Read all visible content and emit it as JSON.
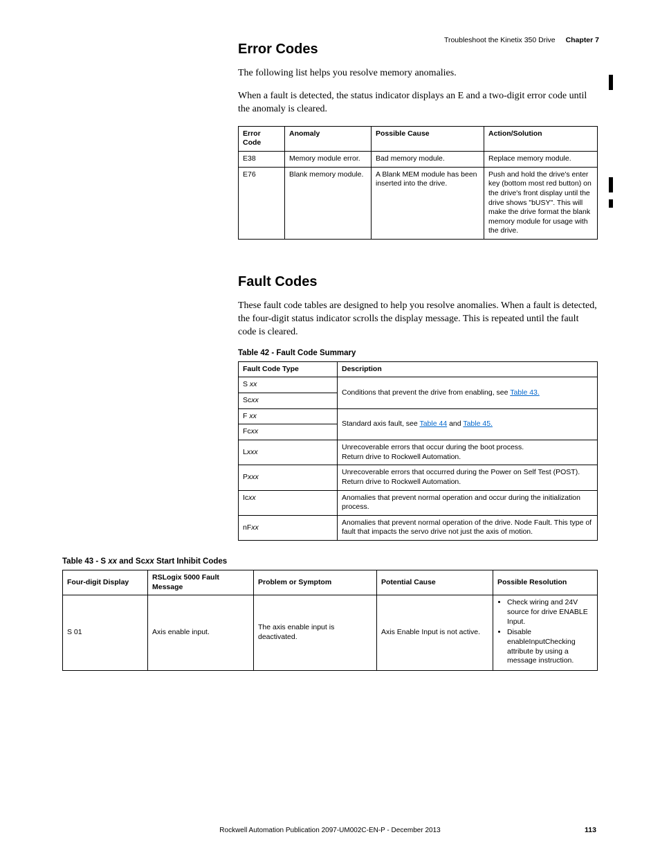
{
  "header": {
    "breadcrumb": "Troubleshoot the Kinetix 350 Drive",
    "chapter": "Chapter 7"
  },
  "sectionA": {
    "title": "Error Codes",
    "p1": "The following list helps you resolve memory anomalies.",
    "p2": "When a fault is detected, the status indicator displays an E and a two-digit error code until the anomaly is cleared."
  },
  "errorTable": {
    "headers": [
      "Error Code",
      "Anomaly",
      "Possible Cause",
      "Action/Solution"
    ],
    "rows": [
      {
        "code": "E38",
        "anomaly": "Memory module error.",
        "cause": "Bad memory module.",
        "action": "Replace memory module."
      },
      {
        "code": "E76",
        "anomaly": "Blank memory module.",
        "cause": "A Blank MEM module has been inserted into the drive.",
        "action": "Push and hold the drive's enter key (bottom most red button) on the drive's front display until the drive shows \"bUSY\".  This will make the drive format the blank memory module for usage with the drive."
      }
    ]
  },
  "sectionB": {
    "title": "Fault Codes",
    "p1": "These fault code tables are designed to help you resolve anomalies. When a fault is detected, the four-digit status indicator scrolls the display message. This is repeated until the fault code is cleared."
  },
  "faultSummary": {
    "caption": "Table 42 - Fault Code Summary",
    "headers": [
      "Fault Code Type",
      "Description"
    ],
    "rows": [
      {
        "type_pre": "S ",
        "type_it": "xx",
        "desc_pre": "Conditions that prevent the drive from enabling, see ",
        "desc_link": "Table 43.",
        "desc_post": "",
        "rowspan": 2
      },
      {
        "type_pre": "Sc",
        "type_it": "xx"
      },
      {
        "type_pre": "F ",
        "type_it": "xx",
        "desc_pre": "Standard axis fault, see ",
        "desc_link": "Table 44",
        "desc_mid": " and ",
        "desc_link2": "Table 45.",
        "rowspan": 2
      },
      {
        "type_pre": "Fc",
        "type_it": "xx"
      },
      {
        "type_pre": "L",
        "type_it": "xxx",
        "desc_plain": "Unrecoverable errors that occur during the boot process.\nReturn drive to Rockwell Automation."
      },
      {
        "type_pre": "P",
        "type_it": "xxx",
        "desc_plain": "Unrecoverable errors that occurred during the Power on Self Test (POST). Return drive to Rockwell Automation."
      },
      {
        "type_pre": "Ic",
        "type_it": "xx",
        "desc_plain": "Anomalies that prevent normal operation and occur during the initialization process."
      },
      {
        "type_pre": "nF",
        "type_it": "xx",
        "desc_plain": "Anomalies that prevent normal operation of the drive. Node Fault. This type of fault that impacts the servo drive not just the axis of motion."
      }
    ]
  },
  "inhibit": {
    "caption_pre": "Table 43 -  S ",
    "caption_it1": "xx",
    "caption_mid": " and Sc",
    "caption_it2": "xx",
    "caption_post": " Start Inhibit Codes",
    "headers": [
      "Four-digit Display",
      "RSLogix 5000 Fault Message",
      "Problem or Symptom",
      "Potential Cause",
      "Possible Resolution"
    ],
    "row": {
      "display": "S 01",
      "msg": "Axis enable input.",
      "problem": "The axis enable input is deactivated.",
      "cause": "Axis Enable Input is not active.",
      "res1": "Check wiring and 24V source for drive ENABLE Input.",
      "res2": "Disable enableInputChecking attribute by using a message instruction."
    }
  },
  "footer": {
    "pub": "Rockwell Automation Publication 2097-UM002C-EN-P - December 2013",
    "page": "113"
  }
}
